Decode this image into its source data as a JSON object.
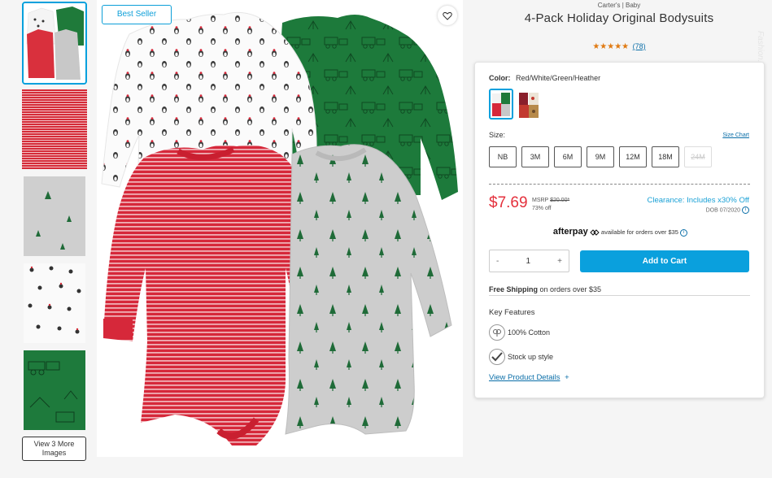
{
  "colors": {
    "accent": "#00a0dd",
    "sale_red": "#e4303c",
    "clearance_blue": "#1aa1d6",
    "star_orange": "#e07a12",
    "link_blue": "#0a6ea8"
  },
  "gallery": {
    "thumbnails": [
      {
        "name": "thumb-all-four",
        "active": true
      },
      {
        "name": "thumb-red-stripe",
        "active": false
      },
      {
        "name": "thumb-gray-trees",
        "active": false
      },
      {
        "name": "thumb-white-penguins",
        "active": false
      },
      {
        "name": "thumb-green-trains",
        "active": false
      }
    ],
    "view_more_line1": "View 3 More",
    "view_more_line2": "Images"
  },
  "main_image": {
    "badge": "Best Seller",
    "wishlist_icon": "heart-icon"
  },
  "product": {
    "brand": "Carter's | Baby",
    "title": "4-Pack Holiday Original Bodysuits",
    "stars": "★★★★★",
    "review_count": "(78)"
  },
  "watermark": "Fashion.com",
  "options": {
    "color_label": "Color:",
    "color_value": "Red/White/Green/Heather",
    "size_label": "Size:",
    "size_chart": "Size Chart",
    "sizes": [
      {
        "label": "NB",
        "available": true
      },
      {
        "label": "3M",
        "available": true
      },
      {
        "label": "6M",
        "available": true
      },
      {
        "label": "9M",
        "available": true
      },
      {
        "label": "12M",
        "available": true
      },
      {
        "label": "18M",
        "available": true
      },
      {
        "label": "24M",
        "available": false
      }
    ]
  },
  "pricing": {
    "price": "$7.69",
    "msrp_label": "MSRP",
    "msrp_value": "$20.00*",
    "percent_off": "73% off",
    "clearance": "Clearance: Includes x30% Off",
    "dob": "DOB 07/2020"
  },
  "afterpay": {
    "brand": "afterpay",
    "text": "available for orders over $35"
  },
  "cart": {
    "minus": "-",
    "quantity": "1",
    "plus": "+",
    "add_label": "Add to Cart"
  },
  "shipping": {
    "bold": "Free Shipping",
    "rest": " on orders over $35"
  },
  "features": {
    "heading": "Key Features",
    "items": [
      {
        "icon": "cotton-icon",
        "text": "100% Cotton"
      },
      {
        "icon": "checkmark-icon",
        "text": "Stock up style"
      }
    ],
    "details_link": "View Product Details",
    "details_plus": "+"
  }
}
